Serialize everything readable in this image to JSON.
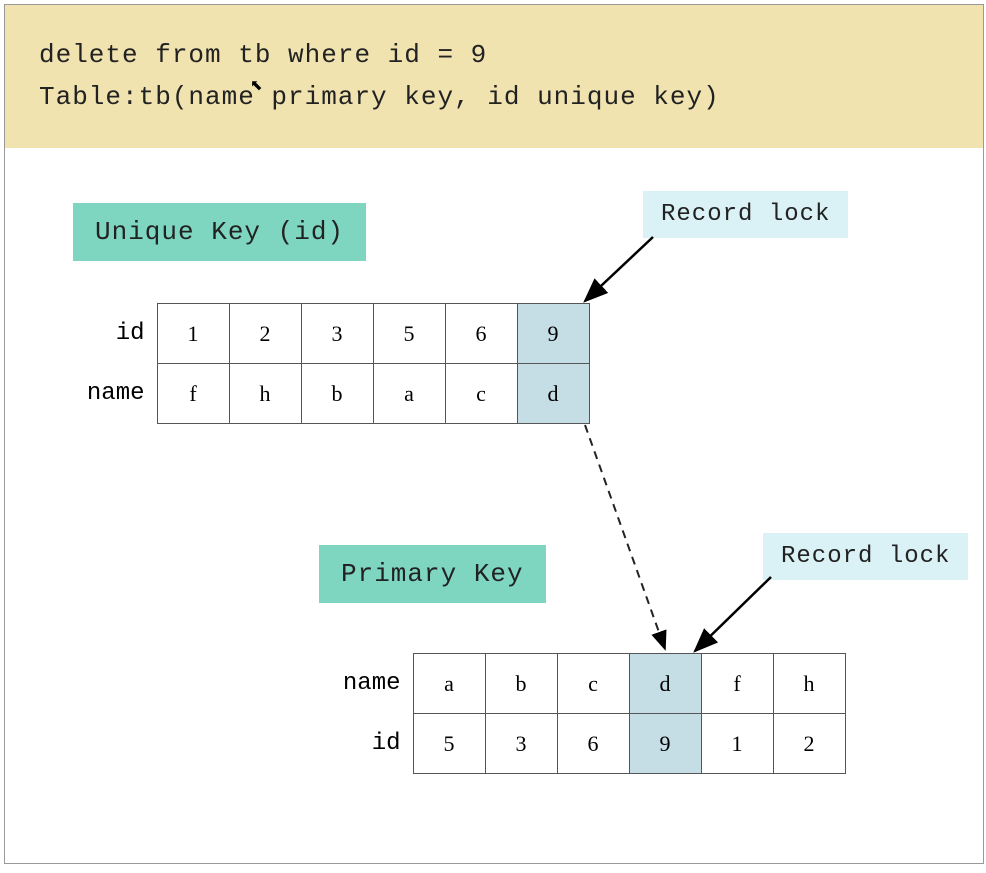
{
  "header": {
    "line1": "delete from tb where id = 9",
    "line2": "Table:tb(name primary key, id unique key)"
  },
  "labels": {
    "unique_key": "Unique Key (id)",
    "primary_key": "Primary Key",
    "record_lock_1": "Record lock",
    "record_lock_2": "Record lock"
  },
  "unique_key_table": {
    "row1_header": "id",
    "row2_header": "name",
    "ids": [
      "1",
      "2",
      "3",
      "5",
      "6",
      "9"
    ],
    "names": [
      "f",
      "h",
      "b",
      "a",
      "c",
      "d"
    ],
    "highlight_index": 5
  },
  "primary_key_table": {
    "row1_header": "name",
    "row2_header": "id",
    "names": [
      "a",
      "b",
      "c",
      "d",
      "f",
      "h"
    ],
    "ids": [
      "5",
      "3",
      "6",
      "9",
      "1",
      "2"
    ],
    "highlight_index": 3
  },
  "colors": {
    "header_bg": "#f0e3b0",
    "label_bg": "#7ed6c1",
    "lock_bg": "#daf2f6",
    "highlight": "#c5dde4"
  }
}
